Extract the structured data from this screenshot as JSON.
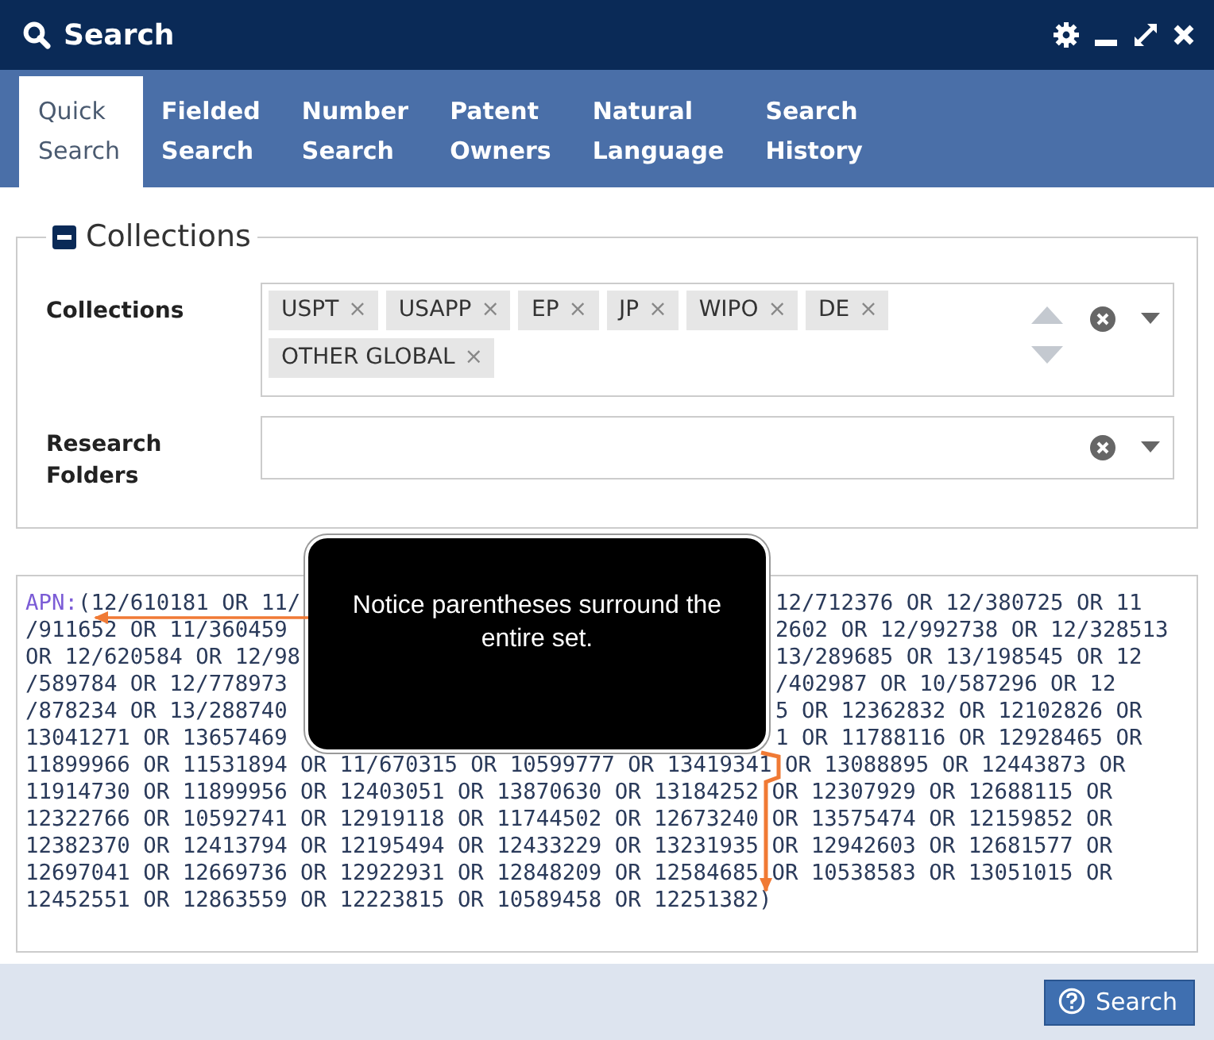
{
  "window": {
    "title": "Search"
  },
  "tabs": [
    {
      "label": "Quick\nSearch",
      "selected": true
    },
    {
      "label": "Fielded\nSearch",
      "selected": false
    },
    {
      "label": "Number\nSearch",
      "selected": false
    },
    {
      "label": "Patent\nOwners",
      "selected": false
    },
    {
      "label": "Natural\nLanguage",
      "selected": false
    },
    {
      "label": "Search\nHistory",
      "selected": false
    }
  ],
  "collections_section": {
    "legend": "Collections",
    "expanded": true,
    "collections": {
      "label": "Collections",
      "tags": [
        "USPT",
        "USAPP",
        "EP",
        "JP",
        "WIPO",
        "DE",
        "OTHER GLOBAL"
      ],
      "tag_remove": "×"
    },
    "research_folders": {
      "label": "Research\nFolders"
    }
  },
  "query": {
    "prefix": "APN:",
    "lines": [
      {
        "left": "(12/610181 OR 11/",
        "right": "12/712376 OR 12/380725 OR 11"
      },
      {
        "left": "/911652 OR 11/360459",
        "right": "2602 OR 12/992738 OR 12/328513"
      },
      {
        "left": "OR 12/620584 OR 12/98",
        "right": "13/289685 OR 13/198545 OR 12"
      },
      {
        "left": "/589784 OR 12/778973",
        "right": "/402987 OR 10/587296 OR 12"
      },
      {
        "left": "/878234 OR 13/288740",
        "right": "5 OR 12362832 OR 12102826 OR"
      },
      {
        "left": "13041271 OR 13657469",
        "right": "1 OR 11788116 OR 12928465 OR"
      },
      {
        "left": "11899966 OR 11531894 OR 11/670315 OR 10599777 OR 13419341 OR 13088895 OR 12443873 OR"
      },
      {
        "left": "11914730 OR 11899956 OR 12403051 OR 13870630 OR 13184252 OR 12307929 OR 12688115 OR"
      },
      {
        "left": "12322766 OR 10592741 OR 12919118 OR 11744502 OR 12673240 OR 13575474 OR 12159852 OR"
      },
      {
        "left": "12382370 OR 12413794 OR 12195494 OR 12433229 OR 13231935 OR 12942603 OR 12681577 OR"
      },
      {
        "left": "12697041 OR 12669736 OR 12922931 OR 12848209 OR 12584685 OR 10538583 OR 13051015 OR"
      },
      {
        "left": "12452551 OR 12863559 OR 12223815 OR 10589458 OR 12251382)"
      }
    ]
  },
  "callout": {
    "text": "Notice parentheses surround the entire set."
  },
  "footer": {
    "search_button": "Search"
  }
}
